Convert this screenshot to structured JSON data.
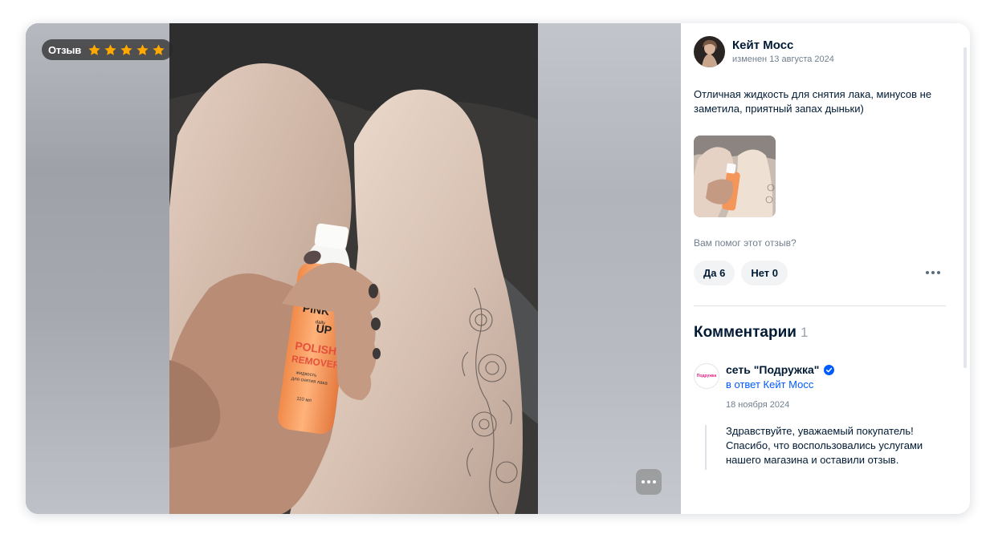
{
  "rating": {
    "label": "Отзыв",
    "stars": 5,
    "max_stars": 5,
    "star_color": "#ffa800",
    "star_icon": "star-icon"
  },
  "photo": {
    "product_brand_line1": "PINK",
    "product_brand_small": "daily",
    "product_brand_line2": "UP",
    "product_name_line1": "POLISH",
    "product_name_line2": "REMOVER",
    "product_desc_line1": "жидкость",
    "product_desc_line2": "для снятия лака",
    "product_volume": "110 мл"
  },
  "review": {
    "author_name": "Кейт Мосс",
    "edited_label": "изменен 13 августа 2024",
    "text": "Отличная жидкость для снятия лака, минусов не заметила, приятный запах дыньки)",
    "helpful_question": "Вам помог этот отзыв?",
    "vote_yes": "Да 6",
    "vote_no": "Нет 0"
  },
  "comments": {
    "title": "Комментарии",
    "count": "1",
    "items": [
      {
        "author": "сеть \"Подружка\"",
        "avatar_text": "Подружка",
        "reply_to": "в ответ Кейт Мосс",
        "date": "18 ноября 2024",
        "text": "Здравствуйте, уважаемый покупатель! Спасибо, что воспользовались услугами нашего магазина и оставили отзыв."
      }
    ]
  },
  "colors": {
    "accent": "#005bff",
    "text": "#001a34",
    "secondary_text": "#707f8d",
    "button_bg": "#f2f3f5",
    "verified": "#005bff"
  }
}
